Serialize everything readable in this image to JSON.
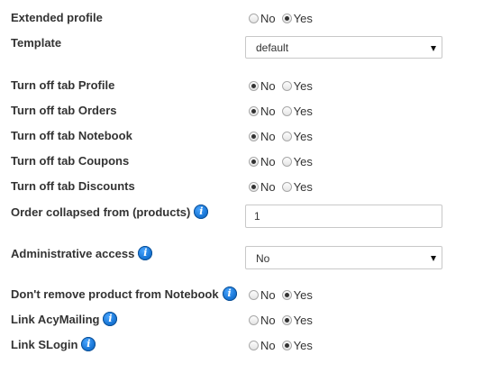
{
  "options": {
    "no": "No",
    "yes": "Yes"
  },
  "extended_profile": {
    "label": "Extended profile",
    "selected": "Yes"
  },
  "template": {
    "label": "Template",
    "value": "default"
  },
  "tab_profile": {
    "label": "Turn off tab Profile",
    "selected": "No"
  },
  "tab_orders": {
    "label": "Turn off tab Orders",
    "selected": "No"
  },
  "tab_notebook": {
    "label": "Turn off tab Notebook",
    "selected": "No"
  },
  "tab_coupons": {
    "label": "Turn off tab Coupons",
    "selected": "No"
  },
  "tab_discounts": {
    "label": "Turn off tab Discounts",
    "selected": "No"
  },
  "order_collapsed": {
    "label": "Order collapsed from (products)",
    "value": "1"
  },
  "admin_access": {
    "label": "Administrative access",
    "value": "No"
  },
  "dont_remove": {
    "label": "Don't remove product from Notebook",
    "selected": "Yes"
  },
  "link_acymailing": {
    "label": "Link AcyMailing",
    "selected": "Yes"
  },
  "link_slogin": {
    "label": "Link SLogin",
    "selected": "Yes"
  },
  "info_icon_glyph": "i",
  "icons": {
    "info": "info-icon",
    "dropdown": "chevron-down-icon"
  },
  "colors": {
    "info_icon": "#1a78d8",
    "text": "#333333",
    "border": "#c8c8c8"
  }
}
